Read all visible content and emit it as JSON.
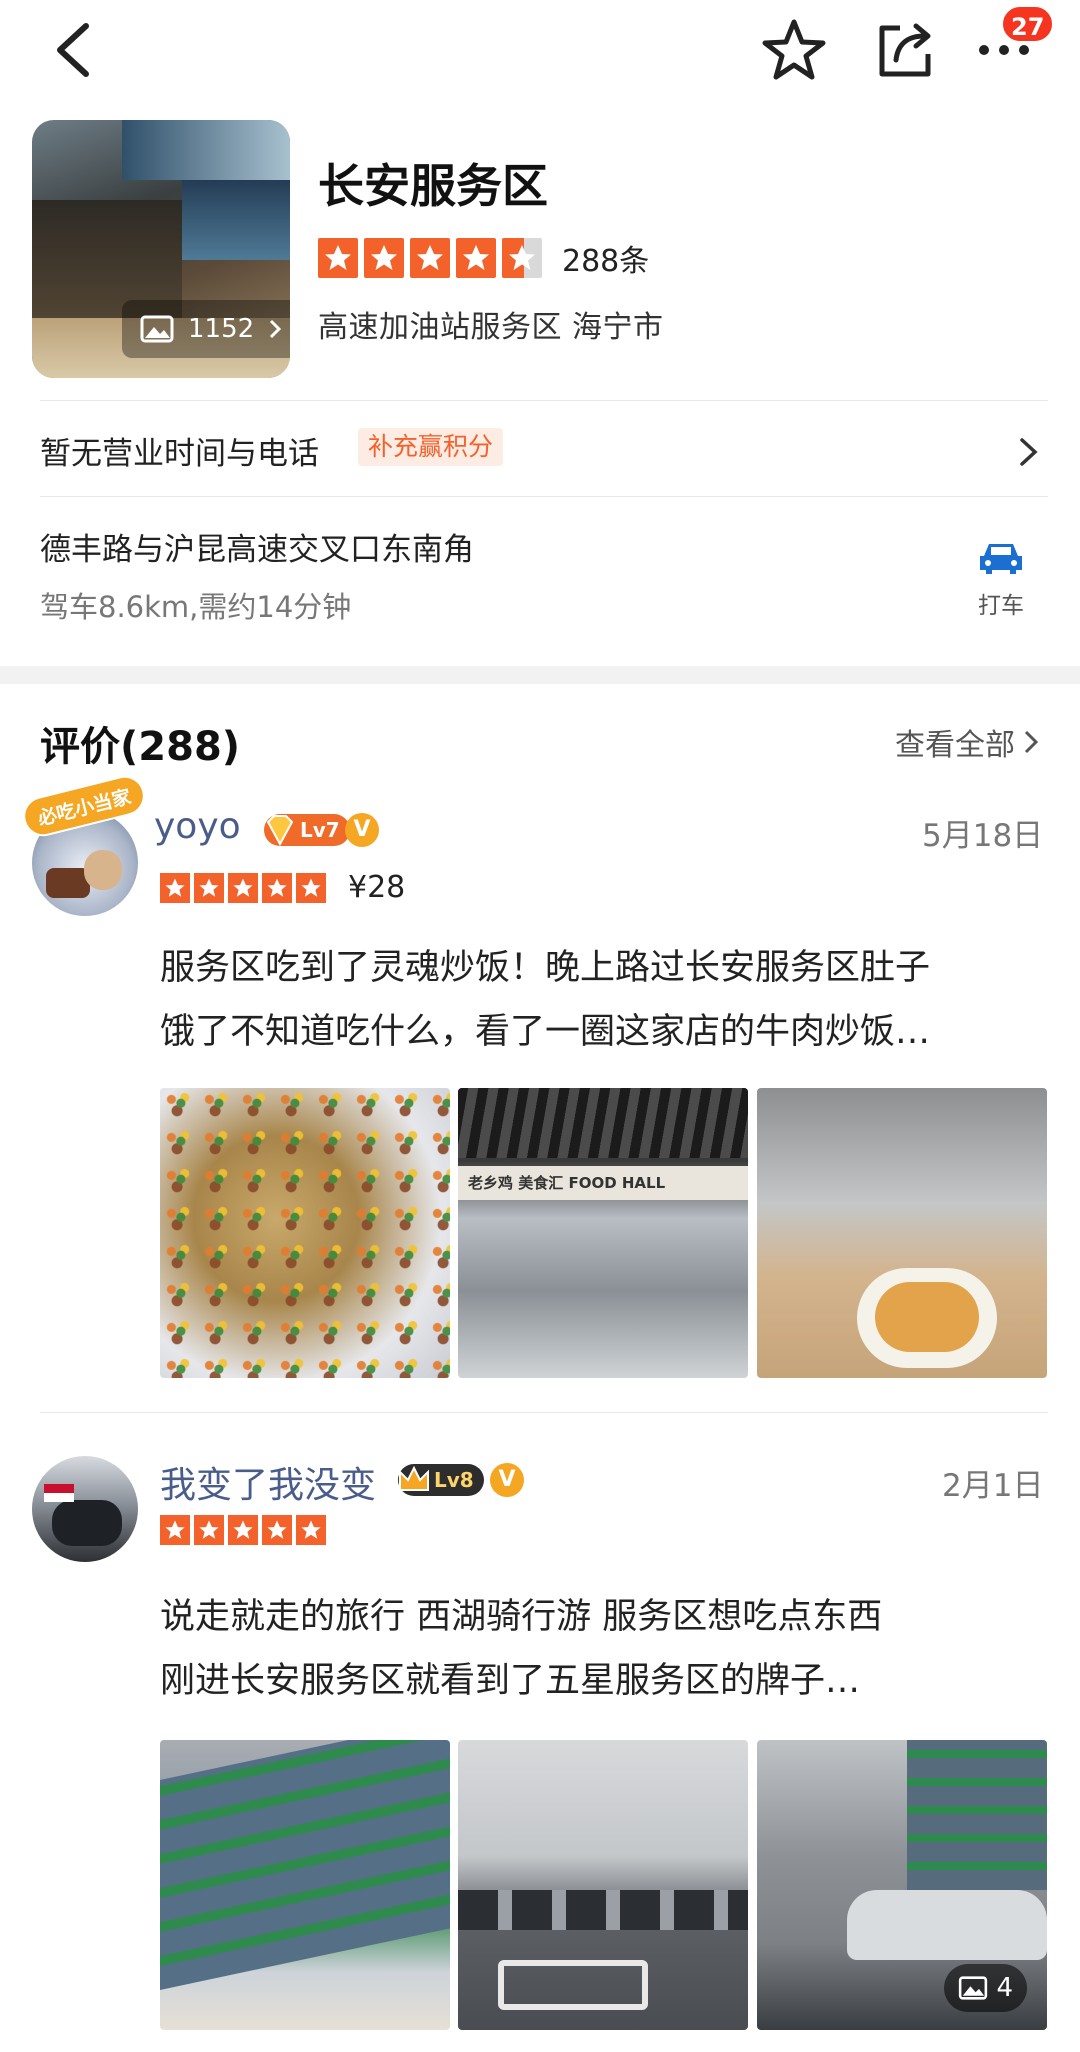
{
  "nav": {
    "notification_count": "27"
  },
  "place": {
    "name": "长安服务区",
    "photo_count": "1152",
    "rating": 4.5,
    "review_count_label": "288条",
    "category": "高速加油站服务区  海宁市"
  },
  "info": {
    "hours_text": "暂无营业时间与电话",
    "bonus_tag": "补充赢积分",
    "address": "德丰路与沪昆高速交叉口东南角",
    "distance": "驾车8.6km,需约14分钟",
    "taxi_label": "打车"
  },
  "reviews": {
    "title": "评价(288)",
    "view_all": "查看全部",
    "items": [
      {
        "username": "yoyo",
        "level": "Lv7",
        "avatar_badge": "必吃小当家",
        "date": "5月18日",
        "stars": 5,
        "price": "¥28",
        "text_line1": "服务区吃到了灵魂炒饭！晚上路过长安服务区肚子",
        "text_line2": "饿了不知道吃什么，看了一圈这家店的牛肉炒饭…",
        "photo2_sign": "老乡鸡  美食汇 FOOD HALL"
      },
      {
        "username": "我变了我没变",
        "level": "Lv8",
        "date": "2月1日",
        "stars": 5,
        "text_line1": "说走就走的旅行 西湖骑行游 服务区想吃点东西",
        "text_line2": "刚进长安服务区就看到了五星服务区的牌子…",
        "image_count": "4"
      }
    ]
  },
  "colors": {
    "accent": "#f4622c",
    "username": "#4a5c8a",
    "badge_red": "#f5351f"
  },
  "icons": [
    "back-icon",
    "star-icon",
    "share-icon",
    "more-icon",
    "image-icon",
    "chevron-right-icon",
    "car-icon",
    "gem-icon",
    "verified-icon"
  ]
}
